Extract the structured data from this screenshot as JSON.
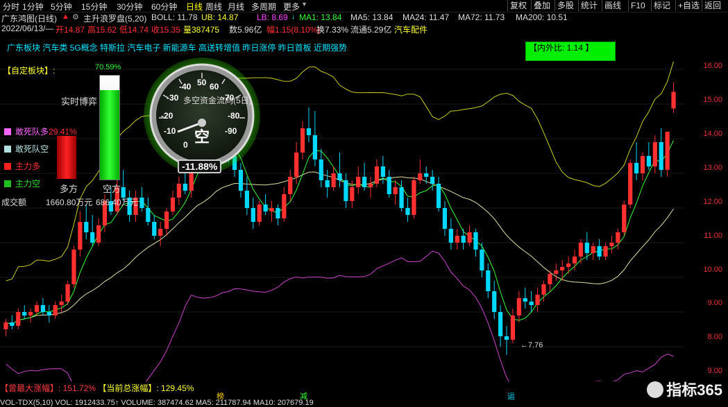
{
  "tabs": [
    "分时",
    "1分钟",
    "5分钟",
    "15分钟",
    "30分钟",
    "60分钟",
    "日线",
    "周线",
    "月线",
    "多周期",
    "更多"
  ],
  "active_tab": "日线",
  "right_buttons": [
    "复权",
    "叠加",
    "多股",
    "统计",
    "画线",
    "F10",
    "标记",
    "+自选",
    "返回"
  ],
  "header": {
    "title": "广东鸿图(日线)",
    "indicator_name": "主升浪罗盘(5,20)",
    "boll": "BOLL: 11.78",
    "ub": "UB: 14.87",
    "lb": "LB: 8.69",
    "ma1": "MA1: 13.84",
    "ma5": "MA5: 13.84",
    "ma24": "MA24: 11.47",
    "ma72": "MA72: 11.73",
    "ma200": "MA200: 10.51"
  },
  "quote": {
    "date": "2022/06/13/—",
    "open": "开14.87",
    "high": "高15.62",
    "low": "低14.74",
    "close": "收15.35",
    "volume": "量387475",
    "amount": "数5.96亿",
    "change": "幅1.15(8.10%)",
    "turnover": "换7.33%",
    "float": "流通5.29亿",
    "sector": "汽车配件"
  },
  "concepts": "广东板块 汽车类 5G概念 特斯拉 汽车电子 新能源车 高送转增值 昨日涨停 昨日首板 近期强势",
  "left_panel": {
    "custom_block": "【自定板块】:",
    "realtime": "实时博弈",
    "percent": "70.59%",
    "legend": [
      {
        "label": "敢死队多",
        "extra": "29.41%",
        "color": "#ff66ff"
      },
      {
        "label": "敢死队空",
        "extra": "",
        "color": "#b0e0e0"
      },
      {
        "label": "主力多",
        "extra": "",
        "color": "#ff2020"
      },
      {
        "label": "主力空",
        "extra": "",
        "color": "#20c020"
      }
    ],
    "duofang": "多方",
    "kongfang": "空方",
    "turnover_label": "成交额",
    "turnover_value": "1660.80万元",
    "turnover_value2": "686.40万元"
  },
  "gauge": {
    "title": "多空资金流向(5日)",
    "ticks": [
      "-40",
      "-30",
      "-20",
      "-10",
      "0",
      "50",
      "60",
      "-70",
      "-80",
      "-90"
    ],
    "center": "空",
    "value": "-11.88%"
  },
  "ratio_box": "【内外比: 1.14 】",
  "price_axis": [
    "16.00",
    "15.00",
    "14.00",
    "13.00",
    "12.00",
    "11.00",
    "10.00",
    "9.00",
    "8.00",
    "9.00"
  ],
  "low_label": "7.76",
  "bottom": {
    "max_rise": "【曾最大涨幅】: 151.72%",
    "cur_rise": "【当前总涨幅】: 129.45%",
    "marker_bang": "榜",
    "marker_jian": "减",
    "marker_yun": "运",
    "vol_line": "VOL-TDX(5,10)  VOL: 1912433.75↑  VOLUME: 387474.62  MA5: 211787.94  MA10: 207679.19"
  },
  "watermark": "指标365",
  "chart_data": {
    "type": "candlestick",
    "ylim": [
      7.2,
      16.4
    ],
    "candles": [
      [
        8.5,
        8.8,
        8.3,
        8.7
      ],
      [
        8.7,
        8.9,
        8.5,
        8.6
      ],
      [
        8.6,
        9.1,
        8.5,
        9.0
      ],
      [
        9.0,
        9.2,
        8.8,
        8.9
      ],
      [
        8.9,
        9.1,
        8.7,
        9.0
      ],
      [
        9.0,
        9.3,
        8.9,
        9.2
      ],
      [
        9.2,
        9.4,
        8.9,
        9.0
      ],
      [
        9.0,
        9.2,
        8.7,
        8.9
      ],
      [
        8.9,
        9.3,
        8.8,
        9.2
      ],
      [
        9.2,
        9.5,
        9.0,
        9.3
      ],
      [
        9.3,
        9.9,
        9.2,
        9.8
      ],
      [
        9.8,
        10.9,
        9.7,
        10.8
      ],
      [
        10.8,
        11.9,
        10.6,
        11.6
      ],
      [
        11.6,
        12.1,
        11.1,
        11.3
      ],
      [
        11.3,
        11.8,
        10.9,
        11.0
      ],
      [
        11.0,
        11.7,
        10.9,
        11.5
      ],
      [
        11.5,
        12.4,
        11.3,
        12.2
      ],
      [
        12.2,
        12.6,
        11.8,
        11.9
      ],
      [
        11.9,
        12.8,
        11.8,
        12.6
      ],
      [
        12.6,
        13.1,
        12.2,
        12.3
      ],
      [
        12.3,
        12.5,
        11.6,
        11.8
      ],
      [
        11.8,
        12.5,
        11.6,
        12.3
      ],
      [
        12.3,
        12.6,
        11.9,
        12.0
      ],
      [
        12.0,
        12.3,
        11.5,
        11.6
      ],
      [
        11.6,
        11.8,
        11.1,
        11.2
      ],
      [
        11.2,
        11.6,
        10.9,
        11.4
      ],
      [
        11.4,
        12.0,
        11.2,
        11.9
      ],
      [
        11.9,
        12.5,
        11.8,
        12.3
      ],
      [
        12.3,
        12.9,
        12.1,
        12.7
      ],
      [
        12.7,
        13.2,
        12.4,
        12.5
      ],
      [
        12.5,
        13.4,
        12.3,
        13.3
      ],
      [
        13.3,
        14.4,
        13.1,
        14.1
      ],
      [
        14.1,
        14.6,
        13.4,
        13.6
      ],
      [
        13.6,
        14.2,
        13.3,
        13.9
      ],
      [
        13.9,
        14.7,
        13.6,
        14.4
      ],
      [
        14.4,
        14.8,
        13.5,
        13.7
      ],
      [
        13.7,
        14.2,
        13.3,
        13.5
      ],
      [
        13.5,
        13.9,
        12.9,
        13.1
      ],
      [
        13.1,
        13.3,
        12.3,
        12.5
      ],
      [
        12.5,
        12.9,
        11.8,
        12.0
      ],
      [
        12.0,
        12.3,
        11.4,
        11.6
      ],
      [
        11.6,
        12.2,
        11.5,
        12.1
      ],
      [
        12.1,
        12.4,
        11.8,
        11.9
      ],
      [
        11.9,
        12.2,
        11.6,
        12.0
      ],
      [
        12.0,
        12.1,
        11.5,
        11.7
      ],
      [
        11.7,
        12.6,
        11.6,
        12.4
      ],
      [
        12.4,
        13.1,
        12.2,
        12.9
      ],
      [
        12.9,
        13.9,
        12.7,
        13.6
      ],
      [
        13.6,
        14.5,
        13.4,
        14.3
      ],
      [
        14.3,
        14.9,
        13.9,
        14.1
      ],
      [
        14.1,
        14.8,
        13.2,
        13.4
      ],
      [
        13.4,
        13.7,
        12.6,
        12.8
      ],
      [
        12.8,
        13.1,
        12.3,
        12.6
      ],
      [
        12.6,
        13.2,
        12.5,
        13.0
      ],
      [
        13.0,
        13.6,
        12.6,
        12.8
      ],
      [
        12.8,
        13.0,
        12.0,
        12.2
      ],
      [
        12.2,
        12.8,
        12.0,
        12.6
      ],
      [
        12.6,
        13.2,
        12.4,
        12.9
      ],
      [
        12.9,
        13.3,
        12.5,
        12.6
      ],
      [
        12.6,
        12.9,
        12.3,
        12.7
      ],
      [
        12.7,
        13.4,
        12.6,
        13.2
      ],
      [
        13.2,
        13.5,
        12.7,
        12.9
      ],
      [
        12.9,
        13.1,
        12.3,
        12.4
      ],
      [
        12.4,
        12.8,
        12.1,
        12.6
      ],
      [
        12.6,
        12.8,
        11.9,
        12.0
      ],
      [
        12.0,
        12.3,
        11.6,
        11.8
      ],
      [
        11.8,
        12.9,
        11.7,
        12.8
      ],
      [
        12.8,
        13.4,
        12.7,
        13.0
      ],
      [
        13.0,
        13.2,
        12.7,
        12.9
      ],
      [
        12.9,
        13.1,
        12.5,
        12.7
      ],
      [
        12.7,
        12.9,
        11.9,
        12.0
      ],
      [
        12.0,
        12.2,
        11.2,
        11.4
      ],
      [
        11.4,
        11.7,
        10.8,
        11.0
      ],
      [
        11.0,
        11.4,
        10.8,
        11.2
      ],
      [
        11.2,
        11.4,
        10.8,
        11.0
      ],
      [
        11.0,
        11.5,
        10.9,
        11.3
      ],
      [
        11.3,
        11.4,
        10.6,
        10.8
      ],
      [
        10.8,
        11.0,
        10.0,
        10.2
      ],
      [
        10.2,
        10.4,
        9.4,
        9.6
      ],
      [
        9.6,
        9.9,
        8.8,
        9.0
      ],
      [
        9.0,
        9.2,
        8.0,
        8.3
      ],
      [
        8.3,
        8.6,
        7.76,
        8.2
      ],
      [
        8.2,
        9.1,
        8.1,
        8.9
      ],
      [
        8.9,
        9.6,
        8.7,
        9.4
      ],
      [
        9.4,
        9.7,
        9.1,
        9.3
      ],
      [
        9.3,
        9.6,
        9.0,
        9.2
      ],
      [
        9.2,
        9.7,
        9.0,
        9.5
      ],
      [
        9.5,
        9.9,
        9.3,
        9.8
      ],
      [
        9.8,
        10.2,
        9.6,
        10.1
      ],
      [
        10.1,
        10.4,
        9.9,
        10.2
      ],
      [
        10.2,
        10.5,
        9.9,
        10.3
      ],
      [
        10.3,
        10.6,
        10.1,
        10.4
      ],
      [
        10.4,
        10.8,
        10.2,
        10.6
      ],
      [
        10.6,
        11.1,
        10.4,
        11.0
      ],
      [
        11.0,
        11.3,
        10.5,
        10.7
      ],
      [
        10.7,
        11.0,
        10.5,
        10.9
      ],
      [
        10.9,
        11.1,
        10.5,
        10.6
      ],
      [
        10.6,
        11.0,
        10.5,
        10.9
      ],
      [
        10.9,
        11.2,
        10.7,
        11.0
      ],
      [
        11.0,
        11.4,
        10.8,
        11.3
      ],
      [
        11.3,
        12.2,
        11.2,
        12.1
      ],
      [
        12.1,
        13.4,
        12.0,
        13.3
      ],
      [
        13.3,
        13.9,
        12.8,
        13.0
      ],
      [
        13.0,
        13.6,
        12.8,
        13.5
      ],
      [
        13.5,
        13.9,
        13.1,
        13.2
      ],
      [
        13.2,
        14.1,
        13.0,
        13.9
      ],
      [
        13.9,
        14.3,
        12.9,
        13.1
      ],
      [
        13.1,
        14.2,
        12.9,
        14.2
      ],
      [
        14.87,
        15.62,
        14.74,
        15.35
      ]
    ]
  }
}
